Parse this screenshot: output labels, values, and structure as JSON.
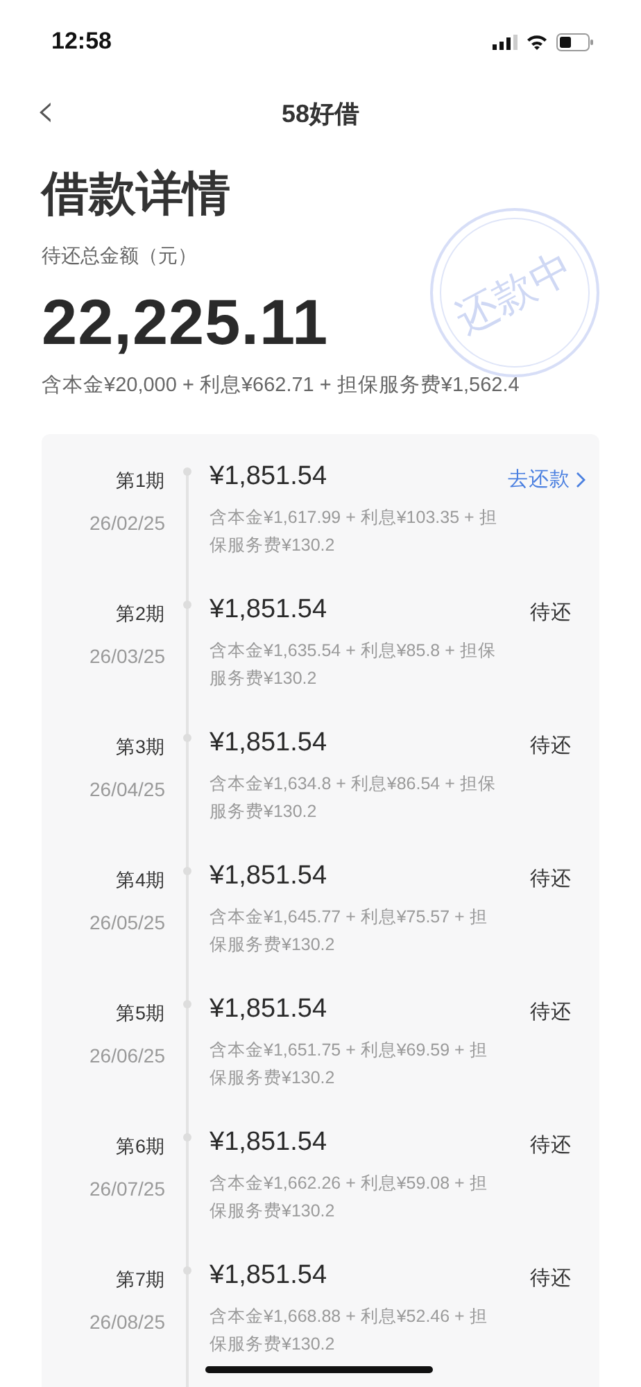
{
  "status_bar": {
    "time": "12:58"
  },
  "nav": {
    "back": "‹",
    "title": "58好借"
  },
  "header": {
    "title": "借款详情",
    "stamp": "还款中",
    "total_label": "待还总金额（元）",
    "total": "22,225.11",
    "breakdown": "含本金¥20,000 + 利息¥662.71 + 担保服务费¥1,562.4"
  },
  "installments": [
    {
      "period": "第1期",
      "date": "26/02/25",
      "amount": "¥1,851.54",
      "breakdown": "含本金¥1,617.99 + 利息¥103.35 + 担保服务费¥130.2",
      "kind": "action",
      "status": "去还款"
    },
    {
      "period": "第2期",
      "date": "26/03/25",
      "amount": "¥1,851.54",
      "breakdown": "含本金¥1,635.54 + 利息¥85.8 + 担保服务费¥130.2",
      "kind": "pending",
      "status": "待还"
    },
    {
      "period": "第3期",
      "date": "26/04/25",
      "amount": "¥1,851.54",
      "breakdown": "含本金¥1,634.8 + 利息¥86.54 + 担保服务费¥130.2",
      "kind": "pending",
      "status": "待还"
    },
    {
      "period": "第4期",
      "date": "26/05/25",
      "amount": "¥1,851.54",
      "breakdown": "含本金¥1,645.77 + 利息¥75.57 + 担保服务费¥130.2",
      "kind": "pending",
      "status": "待还"
    },
    {
      "period": "第5期",
      "date": "26/06/25",
      "amount": "¥1,851.54",
      "breakdown": "含本金¥1,651.75 + 利息¥69.59 + 担保服务费¥130.2",
      "kind": "pending",
      "status": "待还"
    },
    {
      "period": "第6期",
      "date": "26/07/25",
      "amount": "¥1,851.54",
      "breakdown": "含本金¥1,662.26 + 利息¥59.08 + 担保服务费¥130.2",
      "kind": "pending",
      "status": "待还"
    },
    {
      "period": "第7期",
      "date": "26/08/25",
      "amount": "¥1,851.54",
      "breakdown": "含本金¥1,668.88 + 利息¥52.46 + 担保服务费¥130.2",
      "kind": "pending",
      "status": "待还"
    }
  ]
}
